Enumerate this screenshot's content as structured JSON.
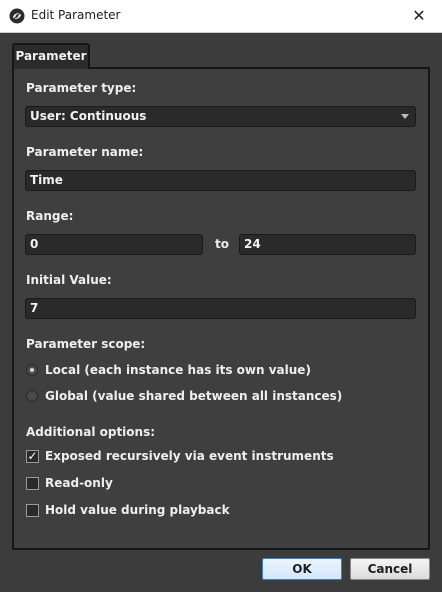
{
  "window": {
    "title": "Edit Parameter",
    "close_glyph": "✕",
    "app_icon": "fmod-swirl-icon"
  },
  "tabs": [
    {
      "label": "Parameter",
      "selected": true
    }
  ],
  "parameter_type": {
    "label": "Parameter type:",
    "value": "User: Continuous"
  },
  "parameter_name": {
    "label": "Parameter name:",
    "value": "Time"
  },
  "range": {
    "label": "Range:",
    "min": "0",
    "to_label": "to",
    "max": "24"
  },
  "initial_value": {
    "label": "Initial Value:",
    "value": "7"
  },
  "scope": {
    "label": "Parameter scope:",
    "options": [
      {
        "label": "Local (each instance has its own value)",
        "selected": true
      },
      {
        "label": "Global (value shared between all instances)",
        "selected": false
      }
    ]
  },
  "additional_options": {
    "label": "Additional options:",
    "options": [
      {
        "label": "Exposed recursively via event instruments",
        "checked": true
      },
      {
        "label": "Read-only",
        "checked": false
      },
      {
        "label": "Hold value during playback",
        "checked": false
      }
    ]
  },
  "buttons": {
    "ok": "OK",
    "cancel": "Cancel"
  },
  "colors": {
    "background": "#3c3c3c",
    "field": "#2a2a2a",
    "accent": "#3c7fc6"
  }
}
